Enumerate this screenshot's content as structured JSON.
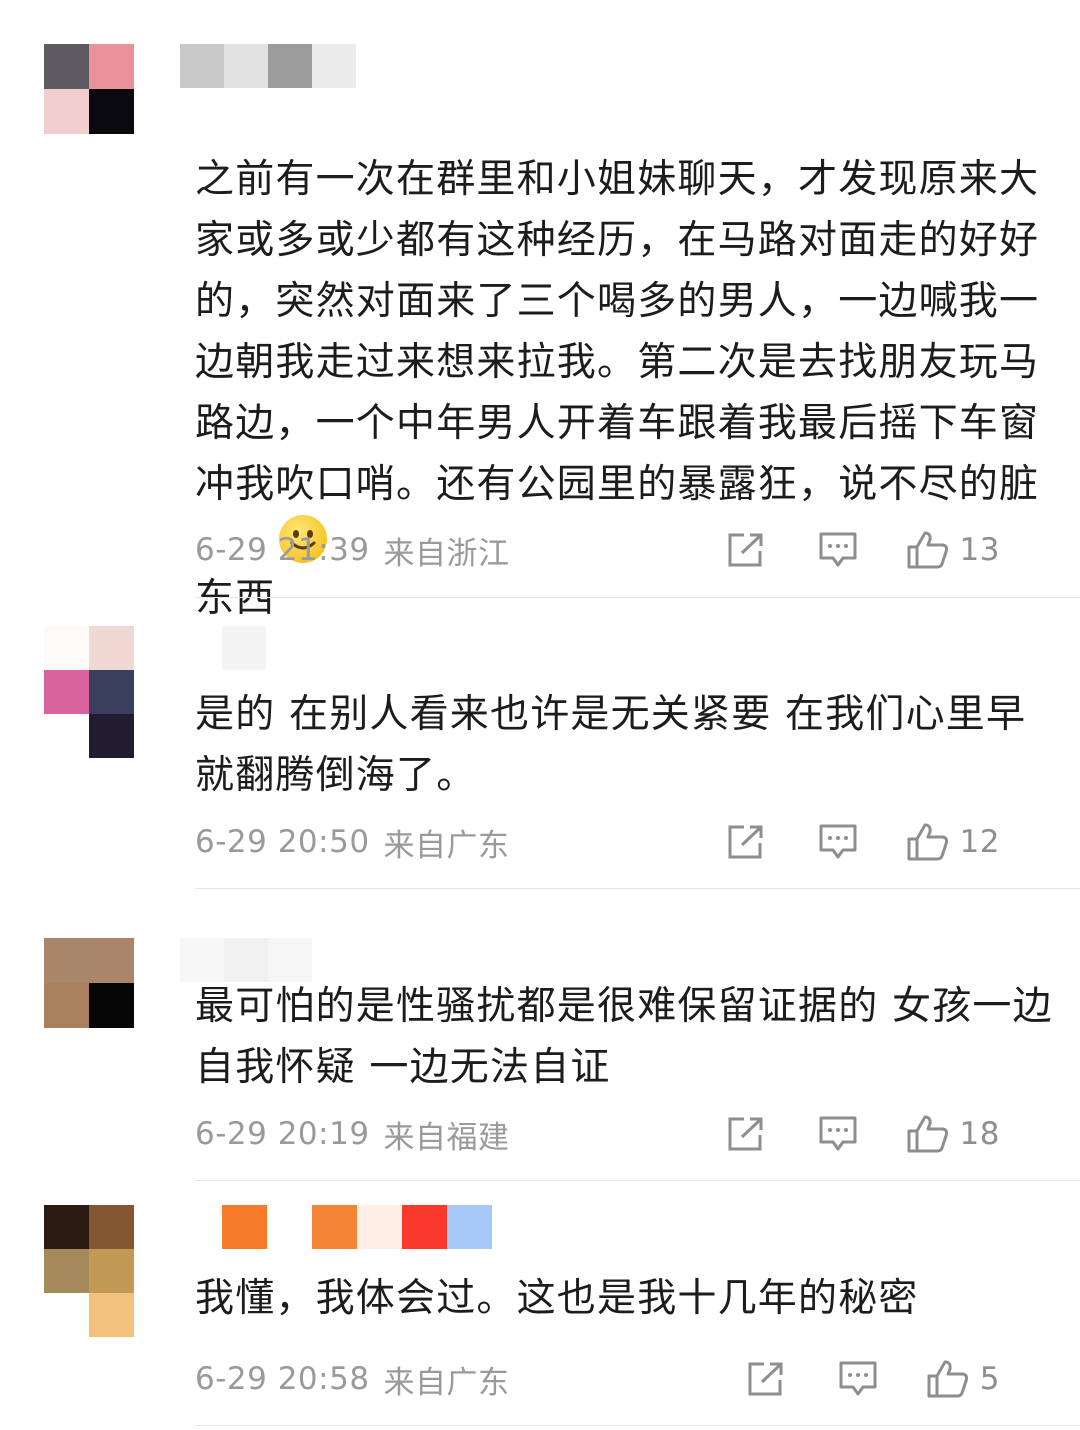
{
  "comments": [
    {
      "text": "之前有一次在群里和小姐妹聊天，才发现原来大家或多或少都有这种经历，在马路对面走的好好的，突然对面来了三个喝多的男人，一边喊我一边朝我走过来想来拉我。第二次是去找朋友玩马路边，一个中年男人开着车跟着我最后摇下车窗冲我吹口哨。还有公园里的暴露狂，说不尽的脏东西",
      "emoji": "smile-emoji",
      "time": "6-29 21:39",
      "location": "来自浙江",
      "likes": "13",
      "avatar_colors": [
        "#5d5a60",
        "#e8939c",
        "#f2cfcf",
        "#0a0a0e"
      ],
      "name_colors": [
        "#c8c8c8",
        "#e2e2e2",
        "#9d9d9d",
        "#ececec"
      ]
    },
    {
      "text": "是的 在别人看来也许是无关紧要 在我们心里早就翻腾倒海了。",
      "time": "6-29 20:50",
      "location": "来自广东",
      "likes": "12",
      "avatar_colors": [
        "#fdfafa",
        "#f1d9d3",
        "#d9649c",
        "#3a3f5e",
        "#ffffff",
        "#211c30"
      ],
      "name_colors": [
        "#f4f4f4"
      ]
    },
    {
      "text": "最可怕的是性骚扰都是很难保留证据的 女孩一边自我怀疑 一边无法自证",
      "time": "6-29 20:19",
      "location": "来自福建",
      "likes": "18",
      "avatar_colors": [
        "#a98669",
        "#ab8569",
        "#a9815f",
        "#060606"
      ],
      "name_colors": [
        "#f7f7f7",
        "#f0f0f0",
        "#f5f5f5"
      ]
    },
    {
      "text": "我懂，我体会过。这也是我十几年的秘密",
      "time": "6-29 20:58",
      "location": "来自广东",
      "likes": "5",
      "avatar_colors": [
        "#2b1a12",
        "#825732",
        "#a58a5c",
        "#c39a55",
        "#ffffff",
        "#f2c17c"
      ],
      "name_colors": [
        "#f57b2b",
        "#ffffff",
        "#f58536",
        "#fdeee6",
        "#f9392b",
        "#a6c8f7"
      ]
    }
  ]
}
